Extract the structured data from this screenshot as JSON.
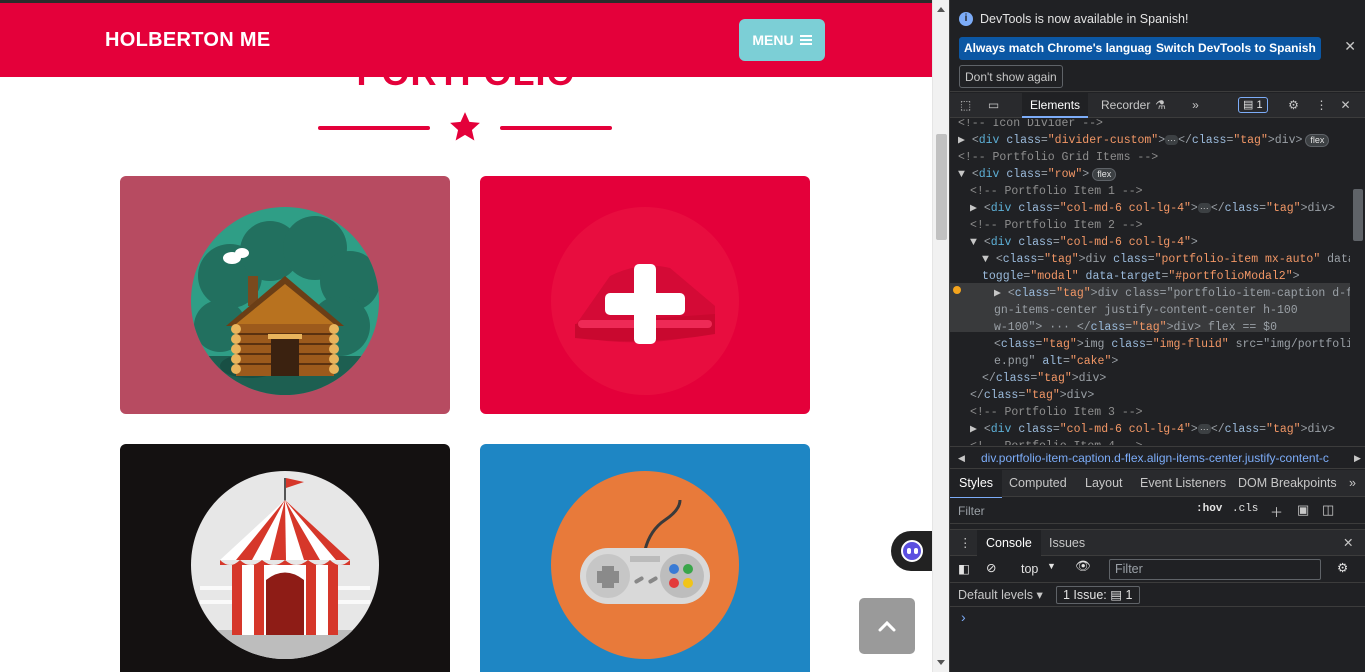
{
  "site": {
    "brand": "HOLBERTON ME",
    "menu_label": "MENU",
    "section_heading": "PORTFOLIO",
    "colors": {
      "primary": "#e4003a",
      "menu_button": "#7ccfd6"
    },
    "portfolio_items": [
      {
        "name": "cabin",
        "bg": "#b74b61"
      },
      {
        "name": "cake",
        "bg": "#e4003a"
      },
      {
        "name": "circus",
        "bg": "#141111"
      },
      {
        "name": "game",
        "bg": "#1e86c4"
      }
    ]
  },
  "devtools": {
    "banner": {
      "message": "DevTools is now available in Spanish!",
      "btn_match": "Always match Chrome's language",
      "btn_switch": "Switch DevTools to Spanish",
      "btn_dont_show": "Don't show again"
    },
    "tabs": {
      "elements": "Elements",
      "recorder": "Recorder",
      "issues_count": "1"
    },
    "crumb": "div.portfolio-item-caption.d-flex.align-items-center.justify-content-c",
    "subtabs": [
      "Styles",
      "Computed",
      "Layout",
      "Event Listeners",
      "DOM Breakpoints"
    ],
    "filter_placeholder": "Filter",
    "hov": ":hov",
    "cls": ".cls",
    "console_tabs": [
      "Console",
      "Issues"
    ],
    "console": {
      "context": "top",
      "filter_placeholder": "Filter",
      "levels": "Default levels",
      "issues_label": "1 Issue:",
      "issues_count": "1"
    },
    "dom_lines": [
      {
        "indent": 5,
        "type": "comment",
        "text": "<!-- Icon Divider -->"
      },
      {
        "indent": 5,
        "type": "collapsed",
        "tag": "div",
        "attrs": [
          [
            "class",
            "divider-custom"
          ]
        ],
        "close": "</div>",
        "badge": "flex"
      },
      {
        "indent": 5,
        "type": "comment",
        "text": "<!-- Portfolio Grid Items -->"
      },
      {
        "indent": 5,
        "type": "open",
        "tag": "div",
        "attrs": [
          [
            "class",
            "row"
          ]
        ],
        "badge": "flex"
      },
      {
        "indent": 6,
        "type": "comment",
        "text": "<!-- Portfolio Item 1 -->"
      },
      {
        "indent": 6,
        "type": "collapsed",
        "tag": "div",
        "attrs": [
          [
            "class",
            "col-md-6 col-lg-4"
          ]
        ],
        "close": "</div>"
      },
      {
        "indent": 6,
        "type": "comment",
        "text": "<!-- Portfolio Item 2 -->"
      },
      {
        "indent": 6,
        "type": "open",
        "tag": "div",
        "attrs": [
          [
            "class",
            "col-md-6 col-lg-4"
          ]
        ]
      },
      {
        "indent": 7,
        "type": "open",
        "tag": "div",
        "attrs": [
          [
            "class",
            "portfolio-item mx-auto"
          ],
          [
            "data-",
            ""
          ]
        ],
        "raw": "<div class=\"portfolio-item mx-auto\" data-"
      },
      {
        "indent": 7,
        "type": "cont",
        "raw": "toggle=\"modal\" data-target=\"#portfolioModal2\">"
      },
      {
        "indent": 8,
        "type": "selected",
        "raw": "<div class=\"portfolio-item-caption d-flex ali"
      },
      {
        "indent": 8,
        "type": "cont",
        "raw": "gn-items-center justify-content-center h-100"
      },
      {
        "indent": 8,
        "type": "cont",
        "raw": "w-100\"> ··· </div> flex == $0"
      },
      {
        "indent": 8,
        "type": "cont",
        "raw": "<img class=\"img-fluid\" src=\"img/portfolio/cak"
      },
      {
        "indent": 8,
        "type": "cont",
        "raw": "e.png\" alt=\"cake\">"
      },
      {
        "indent": 7,
        "type": "cont",
        "raw": "</div>"
      },
      {
        "indent": 6,
        "type": "cont",
        "raw": "</div>"
      },
      {
        "indent": 6,
        "type": "comment",
        "text": "<!-- Portfolio Item 3 -->"
      },
      {
        "indent": 6,
        "type": "collapsed",
        "tag": "div",
        "attrs": [
          [
            "class",
            "col-md-6 col-lg-4"
          ]
        ],
        "close": "</div>"
      },
      {
        "indent": 6,
        "type": "comment",
        "text": "<!-- Portfolio Item 4 -->"
      }
    ]
  }
}
